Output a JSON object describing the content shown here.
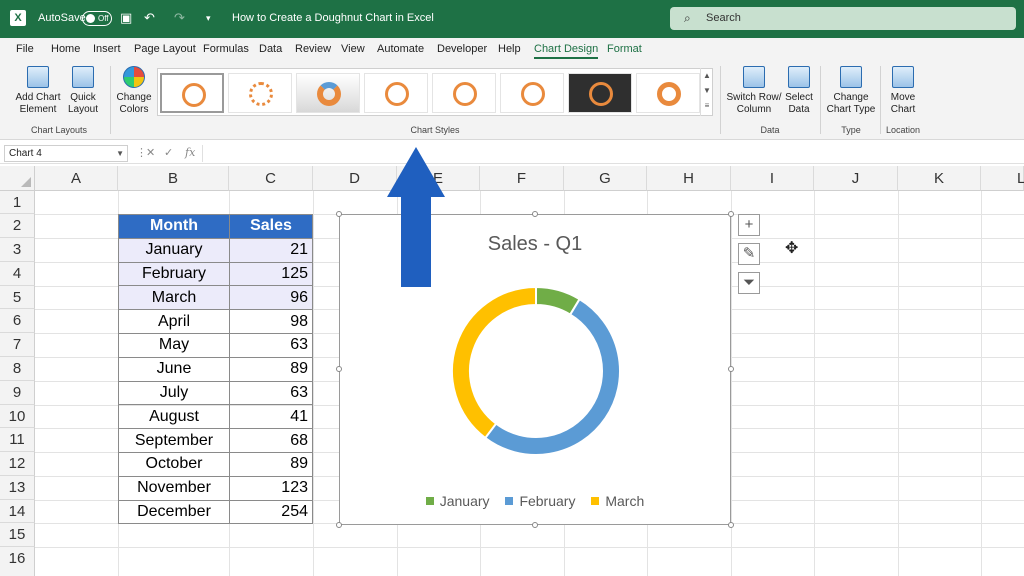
{
  "titlebar": {
    "autosave_label": "AutoSave",
    "autosave_state": "Off",
    "doc_title": "How to Create a Doughnut Chart in Excel",
    "search_placeholder": "Search"
  },
  "tabs": [
    "File",
    "Home",
    "Insert",
    "Page Layout",
    "Formulas",
    "Data",
    "Review",
    "View",
    "Automate",
    "Developer",
    "Help",
    "Chart Design",
    "Format"
  ],
  "active_tab": "Chart Design",
  "ribbon": {
    "add_chart_element": "Add Chart Element",
    "quick_layout": "Quick Layout",
    "chart_layouts_label": "Chart Layouts",
    "change_colors": "Change Colors",
    "chart_styles_label": "Chart Styles",
    "switch_row_column": "Switch Row/ Column",
    "select_data": "Select Data",
    "data_label": "Data",
    "change_chart_type": "Change Chart Type",
    "type_label": "Type",
    "move_chart": "Move Chart",
    "location_label": "Location"
  },
  "formula_bar": {
    "name_box": "Chart 4",
    "fx": "fx"
  },
  "columns": [
    "A",
    "B",
    "C",
    "D",
    "E",
    "F",
    "G",
    "H",
    "I",
    "J",
    "K",
    "L"
  ],
  "rows": [
    "1",
    "2",
    "3",
    "4",
    "5",
    "6",
    "7",
    "8",
    "9",
    "10",
    "11",
    "12",
    "13",
    "14",
    "15",
    "16"
  ],
  "table": {
    "header": [
      "Month",
      "Sales"
    ],
    "rows": [
      [
        "January",
        "21"
      ],
      [
        "February",
        "125"
      ],
      [
        "March",
        "96"
      ],
      [
        "April",
        "98"
      ],
      [
        "May",
        "63"
      ],
      [
        "June",
        "89"
      ],
      [
        "July",
        "63"
      ],
      [
        "August",
        "41"
      ],
      [
        "September",
        "68"
      ],
      [
        "October",
        "89"
      ],
      [
        "November",
        "123"
      ],
      [
        "December",
        "254"
      ]
    ]
  },
  "chart_data": {
    "type": "doughnut",
    "title": "Sales - Q1",
    "categories": [
      "January",
      "February",
      "March"
    ],
    "values": [
      21,
      125,
      96
    ],
    "colors": [
      "#70ad47",
      "#5b9bd5",
      "#ffc000"
    ],
    "legend": "bottom"
  },
  "side_buttons": [
    "plus-icon",
    "brush-icon",
    "filter-icon"
  ]
}
